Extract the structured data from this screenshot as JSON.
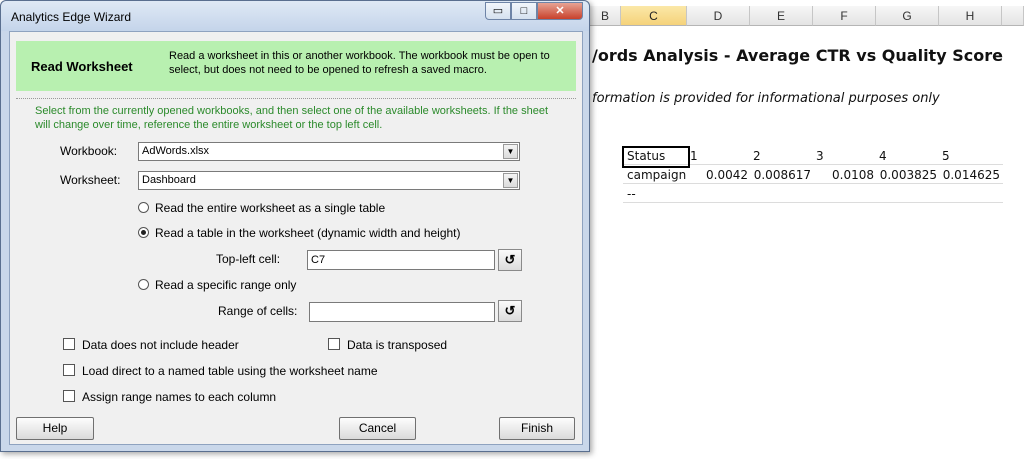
{
  "spreadsheet": {
    "column_headers": [
      "B",
      "C",
      "D",
      "E",
      "F",
      "G",
      "H"
    ],
    "title": "/ords Analysis - Average CTR vs Quality Score",
    "subtitle": "formation is provided for informational purposes only",
    "table": {
      "header": [
        "Status",
        "1",
        "2",
        "3",
        "4",
        "5"
      ],
      "row1": [
        "campaign",
        "0.0042",
        "0.008617",
        "0.0108",
        "0.003825",
        "0.014625"
      ],
      "row2": [
        "--"
      ]
    }
  },
  "dialog": {
    "title": "Analytics Edge Wizard",
    "title_buttons": {
      "minimize": "▭",
      "maximize": "□",
      "close": "✕"
    },
    "banner": {
      "title": "Read Worksheet",
      "description": "Read a worksheet in this or another workbook. The workbook must be open to select, but does not need to be opened to refresh a saved macro."
    },
    "instructions": "Select from the currently opened workbooks, and then select one of the available worksheets. If the sheet will change over time, reference the entire worksheet or the top left cell.",
    "workbook": {
      "label": "Workbook:",
      "value": "AdWords.xlsx"
    },
    "worksheet": {
      "label": "Worksheet:",
      "value": "Dashboard"
    },
    "radios": {
      "entire": "Read the entire worksheet as a single table",
      "dynamic": "Read a table in the worksheet (dynamic width and height)",
      "range": "Read a specific range only",
      "selected": "dynamic"
    },
    "top_left": {
      "label": "Top-left cell:",
      "value": "C7"
    },
    "range_cells": {
      "label": "Range of cells:",
      "value": ""
    },
    "checkboxes": {
      "no_header": "Data does not include header",
      "transposed": "Data is transposed",
      "load_named": "Load direct to a named table using the worksheet name",
      "assign_names": "Assign range names to each column"
    },
    "buttons": {
      "help": "Help",
      "cancel": "Cancel",
      "finish": "Finish"
    },
    "colors": {
      "banner": "#b8f0b0",
      "instructions": "#2b8a2b",
      "chrome": "#c9d7ea"
    }
  }
}
